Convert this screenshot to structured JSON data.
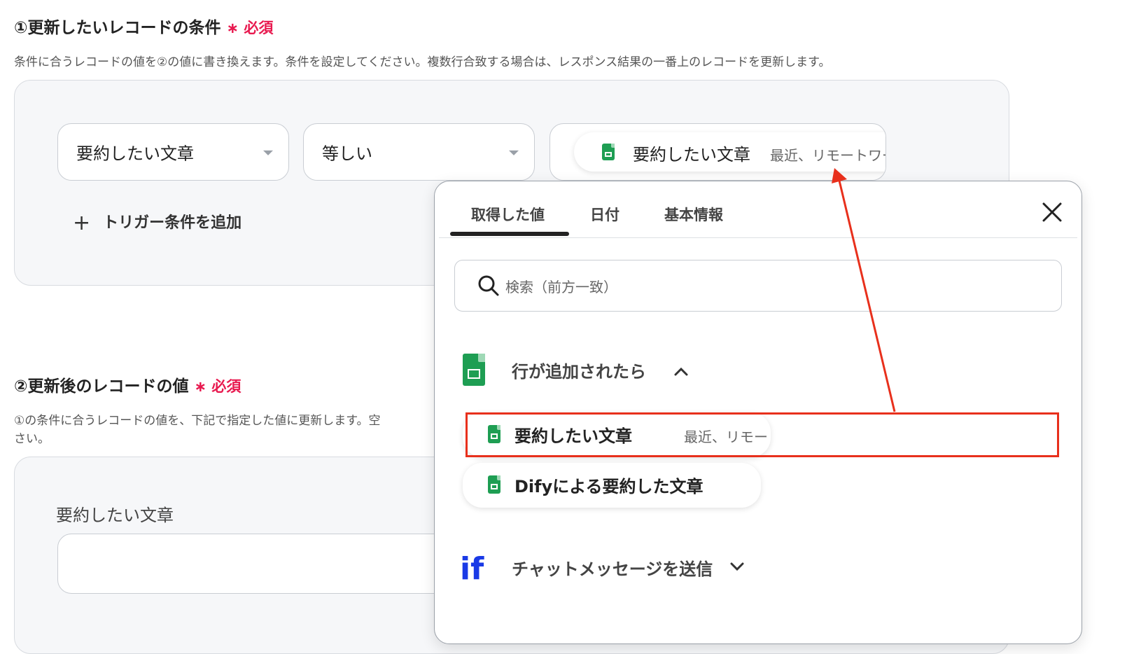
{
  "section1": {
    "title": "①更新したいレコードの条件",
    "required": "∗ 必須",
    "description": "条件に合うレコードの値を②の値に書き換えます。条件を設定してください。複数行合致する場合は、レスポンス結果の一番上のレコードを更新します。",
    "field_select": "要約したい文章",
    "operator_select": "等しい",
    "value_chip": {
      "label": "要約したい文章",
      "preview": "最近、リモートワー"
    },
    "add_condition": "トリガー条件を追加"
  },
  "section2": {
    "title": "②更新後のレコードの値",
    "required": "∗ 必須",
    "description_line1": "①の条件に合うレコードの値を、下記で指定した値に更新します。空",
    "description_line2": "さい。",
    "field_label": "要約したい文章",
    "field_value": ""
  },
  "popup": {
    "tabs": [
      {
        "label": "取得した値",
        "active": true
      },
      {
        "label": "日付",
        "active": false
      },
      {
        "label": "基本情報",
        "active": false
      }
    ],
    "search_placeholder": "検索（前方一致）",
    "groups": [
      {
        "title": "行が追加されたら",
        "icon": "google-sheets-icon",
        "expanded": true,
        "items": [
          {
            "label": "要約したい文章",
            "preview": "最近、リモートワークが普及し、多くの企業が従...",
            "highlighted": true
          },
          {
            "label": "Difyによる要約した文章",
            "preview": "",
            "highlighted": false
          }
        ]
      },
      {
        "title": "チャットメッセージを送信",
        "icon": "dify-if-icon",
        "expanded": false
      }
    ]
  },
  "colors": {
    "required": "#e8194f",
    "sheets_green": "#1e9e53",
    "highlight_red": "#e8301c",
    "dify_blue": "#1a3ae6"
  }
}
